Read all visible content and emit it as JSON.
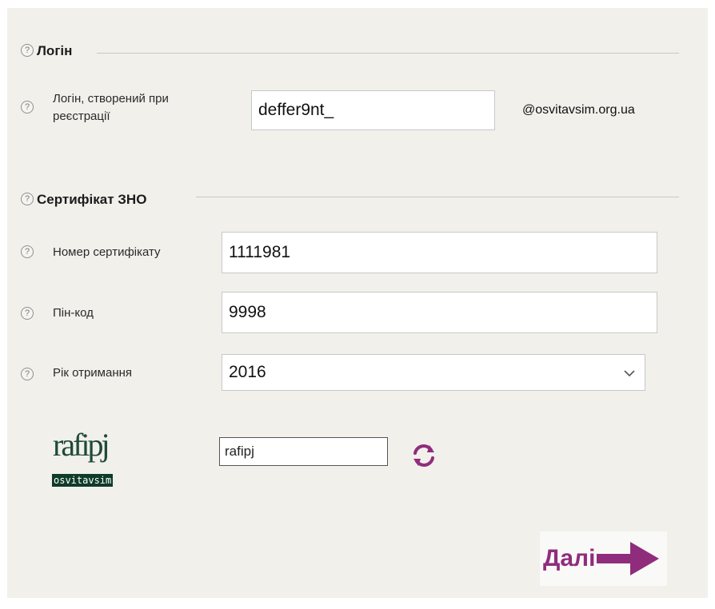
{
  "login_section": {
    "title": "Логін",
    "login_label": "Логін, створений при реєстрації",
    "login_value": "deffer9nt_",
    "domain_suffix": "@osvitavsim.org.ua"
  },
  "certificate_section": {
    "title": "Сертифікат ЗНО",
    "number_label": "Номер сертифікату",
    "number_value": "1111981",
    "pin_label": "Пін-код",
    "pin_value": "9998",
    "year_label": "Рік отримання",
    "year_value": "2016"
  },
  "captcha": {
    "image_text": "rafipj",
    "banner": "osvitavsim",
    "input_value": "rafipj"
  },
  "help_glyph": "?",
  "next_button": {
    "label": "Далі"
  },
  "colors": {
    "accent": "#8f2d7c",
    "panel": "#f1f0eb"
  }
}
